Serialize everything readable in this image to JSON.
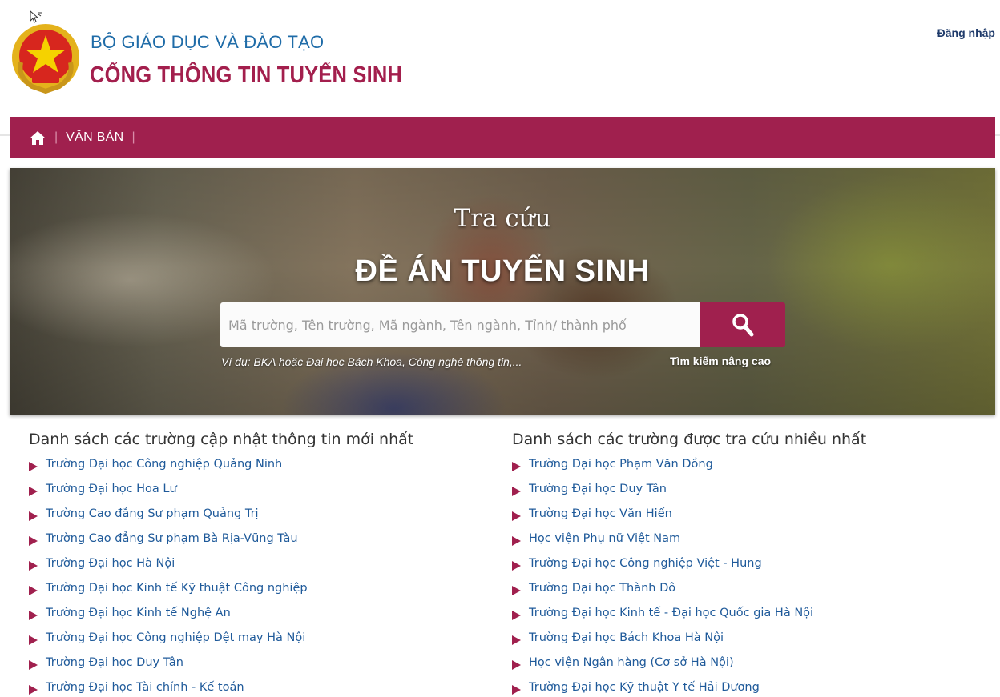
{
  "header": {
    "ministry": "BỘ GIÁO DỤC VÀ ĐÀO TẠO",
    "portal": "CỔNG THÔNG TIN TUYỂN SINH",
    "login": "Đăng nhập"
  },
  "nav": {
    "items": [
      {
        "label": "VĂN BẢN"
      }
    ],
    "separator": "|"
  },
  "hero": {
    "subtitle": "Tra cứu",
    "title": "ĐỀ ÁN TUYỂN SINH",
    "search_placeholder": "Mã trường, Tên trường, Mã ngành, Tên ngành, Tỉnh/ thành phố",
    "search_value": "",
    "hint": "Ví dụ: BKA hoặc Đại học Bách Khoa, Công nghệ thông tin,...",
    "advanced": "Tìm kiếm nâng cao"
  },
  "latest": {
    "heading": "Danh sách các trường cập nhật thông tin mới nhất",
    "items": [
      "Trường Đại học Công nghiệp Quảng Ninh",
      "Trường Đại học Hoa Lư",
      "Trường Cao đẳng Sư phạm Quảng Trị",
      "Trường Cao đẳng Sư phạm Bà Rịa-Vũng Tàu",
      "Trường Đại học Hà Nội",
      "Trường Đại học Kinh tế Kỹ thuật Công nghiệp",
      "Trường Đại học Kinh tế Nghệ An",
      "Trường Đại học Công nghiệp Dệt may Hà Nội",
      "Trường Đại học Duy Tân",
      "Trường Đại học Tài chính - Kế toán"
    ]
  },
  "popular": {
    "heading": "Danh sách các trường được tra cứu nhiều nhất",
    "items": [
      "Trường Đại học Phạm Văn Đồng",
      "Trường Đại học Duy Tân",
      "Trường Đại học Văn Hiến",
      "Học viện Phụ nữ Việt Nam",
      "Trường Đại học Công nghiệp Việt - Hung",
      "Trường Đại học Thành Đô",
      "Trường Đại học Kinh tế - Đại học Quốc gia Hà Nội",
      "Trường Đại học Bách Khoa Hà Nội",
      "Học viện Ngân hàng (Cơ sở Hà Nội)",
      "Trường Đại học Kỹ thuật Y tế Hải Dương"
    ]
  },
  "colors": {
    "brand": "#a0204e",
    "ministry_text": "#1f6ca8",
    "link": "#1f5a9a"
  },
  "icons": [
    "cursor-icon",
    "national-emblem",
    "home-icon",
    "search-icon",
    "bullet-icon"
  ]
}
